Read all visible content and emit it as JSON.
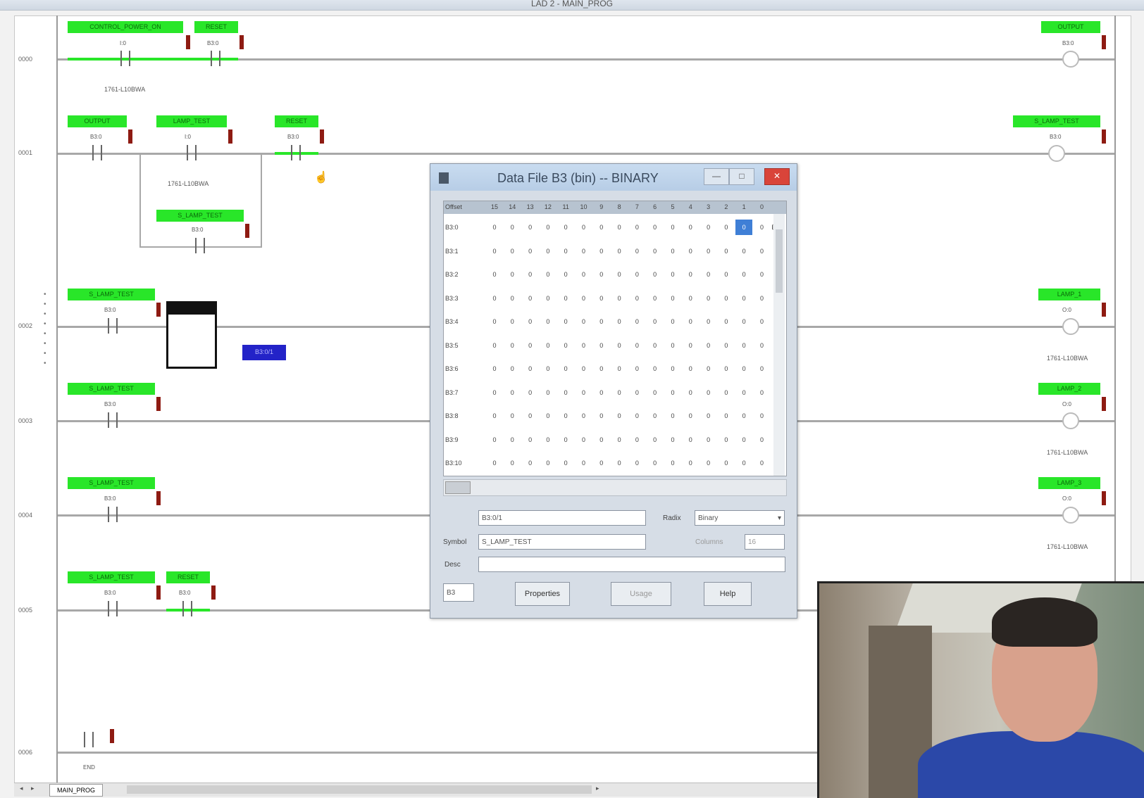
{
  "window": {
    "title": "LAD 2 - MAIN_PROG"
  },
  "rungs": [
    {
      "num": "0000",
      "tags": [
        "CONTROL_POWER_ON",
        "RESET",
        "OUTPUT"
      ],
      "addrs": [
        "I:0",
        "B3:0",
        "B3:0"
      ],
      "desc": [
        "1761-L10BWA"
      ]
    },
    {
      "num": "0001",
      "tags": [
        "OUTPUT",
        "LAMP_TEST",
        "RESET",
        "S_LAMP_TEST",
        "S_LAMP_TEST"
      ],
      "addrs": [
        "B3:0",
        "I:0",
        "B3:0",
        "B3:0",
        "B3:0"
      ],
      "desc": [
        "1761-L10BWA"
      ]
    },
    {
      "num": "0002",
      "tags": [
        "S_LAMP_TEST",
        "LAMP_1"
      ],
      "addrs": [
        "B3:0",
        "O:0"
      ],
      "desc": [
        "1761-L10BWA"
      ]
    },
    {
      "num": "0003",
      "tags": [
        "S_LAMP_TEST",
        "LAMP_2"
      ],
      "addrs": [
        "B3:0",
        "O:0"
      ],
      "desc": [
        "1761-L10BWA"
      ]
    },
    {
      "num": "0004",
      "tags": [
        "S_LAMP_TEST",
        "LAMP_3"
      ],
      "addrs": [
        "B3:0",
        "O:0"
      ],
      "desc": [
        "1761-L10BWA"
      ]
    },
    {
      "num": "0005",
      "tags": [
        "S_LAMP_TEST",
        "RESET"
      ],
      "addrs": [
        "B3:0",
        "B3:0"
      ],
      "desc": []
    },
    {
      "num": "0006",
      "tags": [],
      "addrs": [
        "END"
      ],
      "desc": []
    }
  ],
  "selected_instruction": "B3:0/1",
  "dialog": {
    "title": "Data File B3 (bin) -- BINARY",
    "columns": [
      "Offset",
      "15",
      "14",
      "13",
      "12",
      "11",
      "10",
      "9",
      "8",
      "7",
      "6",
      "5",
      "4",
      "3",
      "2",
      "1",
      "0"
    ],
    "rows": [
      {
        "label": "B3:0",
        "bits": [
          "0",
          "0",
          "0",
          "0",
          "0",
          "0",
          "0",
          "0",
          "0",
          "0",
          "0",
          "0",
          "0",
          "0",
          "0",
          "0"
        ],
        "trail": "Ba"
      },
      {
        "label": "B3:1",
        "bits": [
          "0",
          "0",
          "0",
          "0",
          "0",
          "0",
          "0",
          "0",
          "0",
          "0",
          "0",
          "0",
          "0",
          "0",
          "0",
          "0"
        ]
      },
      {
        "label": "B3:2",
        "bits": [
          "0",
          "0",
          "0",
          "0",
          "0",
          "0",
          "0",
          "0",
          "0",
          "0",
          "0",
          "0",
          "0",
          "0",
          "0",
          "0"
        ]
      },
      {
        "label": "B3:3",
        "bits": [
          "0",
          "0",
          "0",
          "0",
          "0",
          "0",
          "0",
          "0",
          "0",
          "0",
          "0",
          "0",
          "0",
          "0",
          "0",
          "0"
        ]
      },
      {
        "label": "B3:4",
        "bits": [
          "0",
          "0",
          "0",
          "0",
          "0",
          "0",
          "0",
          "0",
          "0",
          "0",
          "0",
          "0",
          "0",
          "0",
          "0",
          "0"
        ]
      },
      {
        "label": "B3:5",
        "bits": [
          "0",
          "0",
          "0",
          "0",
          "0",
          "0",
          "0",
          "0",
          "0",
          "0",
          "0",
          "0",
          "0",
          "0",
          "0",
          "0"
        ]
      },
      {
        "label": "B3:6",
        "bits": [
          "0",
          "0",
          "0",
          "0",
          "0",
          "0",
          "0",
          "0",
          "0",
          "0",
          "0",
          "0",
          "0",
          "0",
          "0",
          "0"
        ]
      },
      {
        "label": "B3:7",
        "bits": [
          "0",
          "0",
          "0",
          "0",
          "0",
          "0",
          "0",
          "0",
          "0",
          "0",
          "0",
          "0",
          "0",
          "0",
          "0",
          "0"
        ]
      },
      {
        "label": "B3:8",
        "bits": [
          "0",
          "0",
          "0",
          "0",
          "0",
          "0",
          "0",
          "0",
          "0",
          "0",
          "0",
          "0",
          "0",
          "0",
          "0",
          "0"
        ]
      },
      {
        "label": "B3:9",
        "bits": [
          "0",
          "0",
          "0",
          "0",
          "0",
          "0",
          "0",
          "0",
          "0",
          "0",
          "0",
          "0",
          "0",
          "0",
          "0",
          "0"
        ]
      },
      {
        "label": "B3:10",
        "bits": [
          "0",
          "0",
          "0",
          "0",
          "0",
          "0",
          "0",
          "0",
          "0",
          "0",
          "0",
          "0",
          "0",
          "0",
          "0",
          "0"
        ]
      }
    ],
    "selected_cell": "B3:0/1",
    "address_value": "B3:0/1",
    "symbol_label": "Symbol",
    "symbol_value": "S_LAMP_TEST",
    "desc_label": "Desc",
    "desc_value": "",
    "radix_label": "Radix",
    "radix_value": "Binary",
    "columns_label": "Columns",
    "columns_value": "16",
    "spin_value": "B3",
    "buttons": {
      "properties": "Properties",
      "usage": "Usage",
      "help": "Help"
    },
    "window_buttons": {
      "min": "—",
      "max": "□",
      "close": "✕"
    }
  },
  "tabs": {
    "active": "MAIN_PROG"
  }
}
